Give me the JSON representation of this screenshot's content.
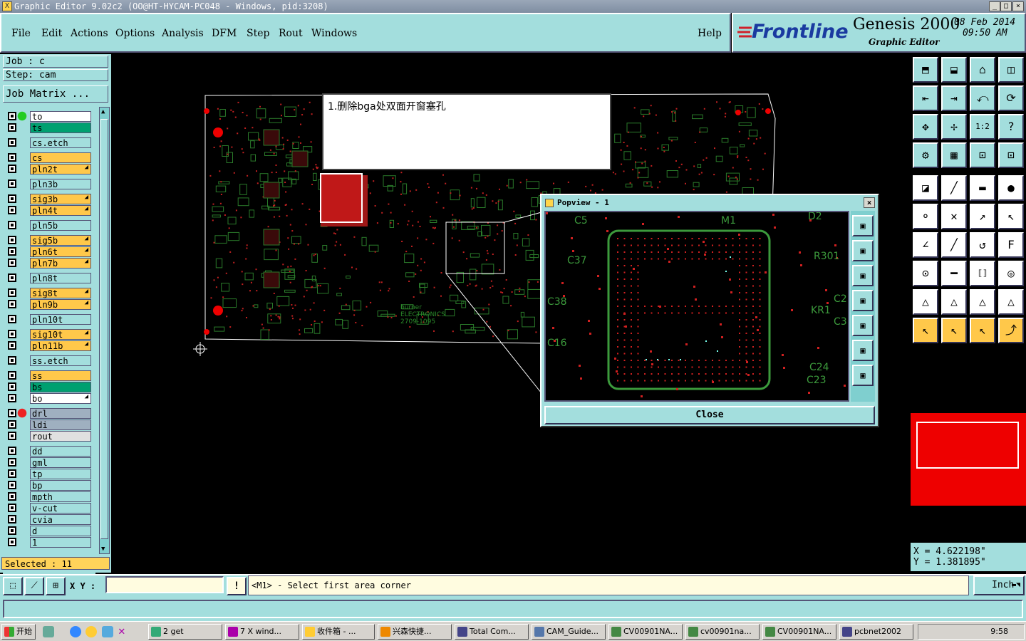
{
  "window": {
    "title": "Graphic Editor 9.02c2 (OO@HT-HYCAM-PC048 - Windows, pid:3208)",
    "buttons": [
      "_",
      "□",
      "×"
    ]
  },
  "menu": {
    "items": [
      "File",
      "Edit",
      "Actions",
      "Options",
      "Analysis",
      "DFM",
      "Step",
      "Rout",
      "Windows"
    ],
    "help": "Help"
  },
  "brand": {
    "logo": "Frontline",
    "product": "Genesis 2000",
    "subtitle": "Graphic Editor",
    "date": "08 Feb 2014",
    "time": "09:50 AM"
  },
  "job": {
    "job_label": "Job : c",
    "step_label": "Step: cam",
    "matrix_button": "Job Matrix ..."
  },
  "layers": [
    {
      "name": "to",
      "color": "#ffffff",
      "sel": "green"
    },
    {
      "name": "ts",
      "color": "#00a070"
    },
    {
      "name": "cs.etch",
      "color": "#a3dedd",
      "gap": true
    },
    {
      "name": "cs",
      "color": "#ffc84a",
      "gap": true
    },
    {
      "name": "pln2t",
      "color": "#ffc84a",
      "arrow": true
    },
    {
      "name": "pln3b",
      "color": "#a3dedd",
      "gap": true
    },
    {
      "name": "sig3b",
      "color": "#ffc84a",
      "arrow": true,
      "gap": true
    },
    {
      "name": "pln4t",
      "color": "#ffc84a",
      "arrow": true
    },
    {
      "name": "pln5b",
      "color": "#a3dedd",
      "gap": true
    },
    {
      "name": "sig5b",
      "color": "#ffc84a",
      "arrow": true,
      "gap": true
    },
    {
      "name": "pln6t",
      "color": "#ffc84a",
      "arrow": true
    },
    {
      "name": "pln7b",
      "color": "#ffc84a",
      "arrow": true
    },
    {
      "name": "pln8t",
      "color": "#a3dedd",
      "gap": true
    },
    {
      "name": "sig8t",
      "color": "#ffc84a",
      "arrow": true,
      "gap": true
    },
    {
      "name": "pln9b",
      "color": "#ffc84a",
      "arrow": true
    },
    {
      "name": "pln10t",
      "color": "#a3dedd",
      "gap": true
    },
    {
      "name": "sig10t",
      "color": "#ffc84a",
      "arrow": true,
      "gap": true
    },
    {
      "name": "pln11b",
      "color": "#ffc84a",
      "arrow": true
    },
    {
      "name": "ss.etch",
      "color": "#a3dedd",
      "gap": true
    },
    {
      "name": "ss",
      "color": "#ffc84a",
      "gap": true
    },
    {
      "name": "bs",
      "color": "#00a070"
    },
    {
      "name": "bo",
      "color": "#ffffff",
      "arrow": true
    },
    {
      "name": "drl",
      "color": "#9fb0c0",
      "sel": "red",
      "gap": true
    },
    {
      "name": "ldi",
      "color": "#9fb0c0"
    },
    {
      "name": "rout",
      "color": "#e0e0e0"
    },
    {
      "name": "dd",
      "color": "#a3dedd",
      "gap": true
    },
    {
      "name": "gml",
      "color": "#a3dedd"
    },
    {
      "name": "tp",
      "color": "#a3dedd"
    },
    {
      "name": "bp",
      "color": "#a3dedd"
    },
    {
      "name": "mpth",
      "color": "#a3dedd"
    },
    {
      "name": "v-cut",
      "color": "#a3dedd"
    },
    {
      "name": "cvia",
      "color": "#a3dedd"
    },
    {
      "name": "d",
      "color": "#a3dedd"
    },
    {
      "name": "1",
      "color": "#a3dedd"
    }
  ],
  "selected": "Selected : 11",
  "note": {
    "text": "1.删除bga处双面开窗塞孔"
  },
  "board": {
    "silk_text": [
      "burner",
      "ELECTRONICS",
      "2709-1095"
    ]
  },
  "popview": {
    "title": "Popview - 1",
    "close_label": "Close",
    "labels": [
      "C5",
      "M1",
      "D2",
      "C37",
      "R301",
      "C38",
      "KR1",
      "C16",
      "C24",
      "C23",
      "C2",
      "C3"
    ]
  },
  "coords": {
    "x": "X = 4.622198\"",
    "y": "Y = 1.381895\""
  },
  "status": {
    "xy_label": "X Y :",
    "hint": "<M1> - Select first area corner",
    "unit": "Inch",
    "warn": "!"
  },
  "taskbar": {
    "start": "开始",
    "tasks": [
      "2 get",
      "7 X wind...",
      "收件箱 - ...",
      "兴森快捷...",
      "Total Com...",
      "CAM_Guide...",
      "CV00901NA...",
      "cv00901na...",
      "CV00901NA...",
      "pcbnet2002"
    ],
    "clock": "9:58"
  }
}
